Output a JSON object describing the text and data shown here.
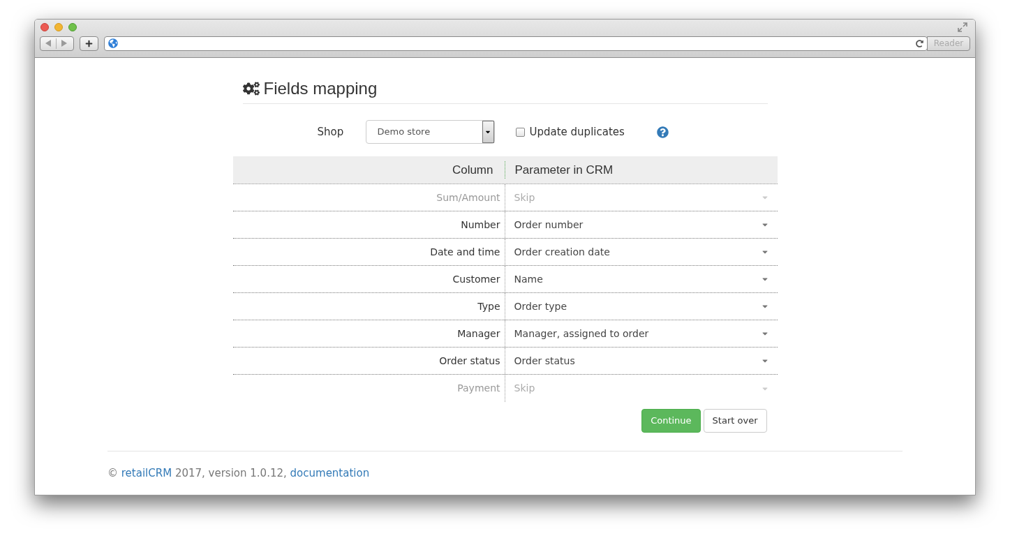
{
  "browser": {
    "reader_button": "Reader"
  },
  "page": {
    "title": "Fields mapping",
    "shop": {
      "label": "Shop",
      "value": "Demo store"
    },
    "update_duplicates": {
      "label": "Update duplicates",
      "checked": false
    },
    "table": {
      "columns": [
        "Column",
        "Parameter in CRM"
      ],
      "rows": [
        {
          "column": "Sum/Amount",
          "parameter": "Skip",
          "disabled": true
        },
        {
          "column": "Number",
          "parameter": "Order number",
          "disabled": false
        },
        {
          "column": "Date and time",
          "parameter": "Order creation date",
          "disabled": false
        },
        {
          "column": "Customer",
          "parameter": "Name",
          "disabled": false
        },
        {
          "column": "Type",
          "parameter": "Order type",
          "disabled": false
        },
        {
          "column": "Manager",
          "parameter": "Manager, assigned to order",
          "disabled": false
        },
        {
          "column": "Order status",
          "parameter": "Order status",
          "disabled": false
        },
        {
          "column": "Payment",
          "parameter": "Skip",
          "disabled": true
        }
      ]
    },
    "buttons": {
      "continue": "Continue",
      "start_over": "Start over"
    }
  },
  "footer": {
    "prefix": "©",
    "brand_link": "retailCRM",
    "text": "2017, version 1.0.12,",
    "docs_link": "documentation"
  }
}
